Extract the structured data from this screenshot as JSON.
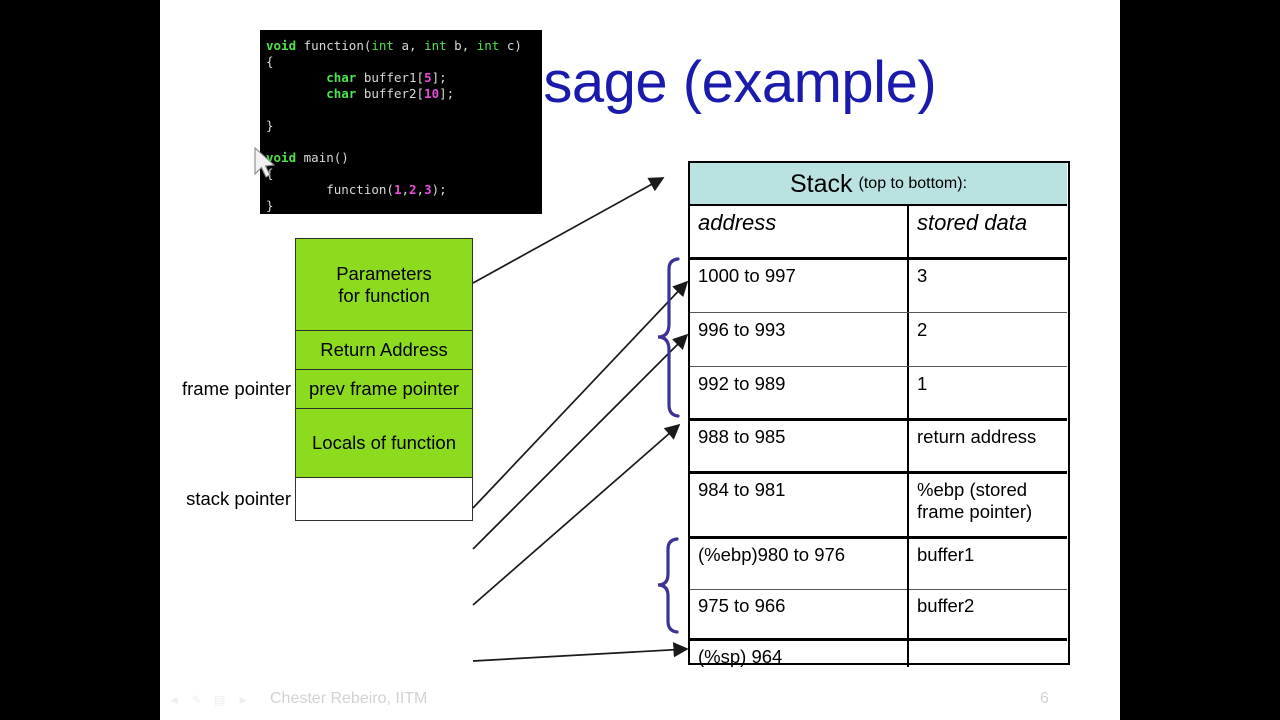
{
  "slide": {
    "title": "Stack Usage (example)"
  },
  "code": {
    "lines": [
      [
        {
          "t": "void ",
          "c": "kw"
        },
        {
          "t": "function(",
          "c": "pl"
        },
        {
          "t": "int",
          "c": "ty"
        },
        {
          "t": " a, ",
          "c": "pl"
        },
        {
          "t": "int",
          "c": "ty"
        },
        {
          "t": " b, ",
          "c": "pl"
        },
        {
          "t": "int",
          "c": "ty"
        },
        {
          "t": " c)",
          "c": "pl"
        }
      ],
      [
        {
          "t": "{",
          "c": "pl"
        }
      ],
      [
        {
          "t": "        ",
          "c": "pl"
        },
        {
          "t": "char",
          "c": "kw"
        },
        {
          "t": " buffer1[",
          "c": "pl"
        },
        {
          "t": "5",
          "c": "num"
        },
        {
          "t": "];",
          "c": "pl"
        }
      ],
      [
        {
          "t": "        ",
          "c": "pl"
        },
        {
          "t": "char",
          "c": "kw"
        },
        {
          "t": " buffer2[",
          "c": "pl"
        },
        {
          "t": "10",
          "c": "num"
        },
        {
          "t": "];",
          "c": "pl"
        }
      ],
      [
        {
          "t": "",
          "c": "pl"
        }
      ],
      [
        {
          "t": "}",
          "c": "pl"
        }
      ],
      [
        {
          "t": "",
          "c": "pl"
        }
      ],
      [
        {
          "t": "void ",
          "c": "kw"
        },
        {
          "t": "main()",
          "c": "pl"
        }
      ],
      [
        {
          "t": "{",
          "c": "pl"
        }
      ],
      [
        {
          "t": "        function(",
          "c": "pl"
        },
        {
          "t": "1",
          "c": "num"
        },
        {
          "t": ",",
          "c": "pl"
        },
        {
          "t": "2",
          "c": "num"
        },
        {
          "t": ",",
          "c": "pl"
        },
        {
          "t": "3",
          "c": "num"
        },
        {
          "t": ");",
          "c": "pl"
        }
      ],
      [
        {
          "t": "}",
          "c": "pl"
        }
      ]
    ]
  },
  "frame": {
    "boxes": [
      {
        "id": "params",
        "label": "Parameters\nfor function",
        "color": "#8ddb1e"
      },
      {
        "id": "return-address",
        "label": "Return Address",
        "color": "#8ddb1e"
      },
      {
        "id": "prev-frame-pointer",
        "label": "prev frame pointer",
        "color": "#8ddb1e"
      },
      {
        "id": "locals",
        "label": "Locals of function",
        "color": "#8ddb1e"
      },
      {
        "id": "free-space",
        "label": "",
        "color": "#ffffff"
      }
    ],
    "side_labels": {
      "frame_pointer": "frame pointer",
      "stack_pointer": "stack pointer"
    }
  },
  "table": {
    "header": {
      "main": "Stack",
      "note": "(top to bottom):",
      "bg": "#b9e2e0"
    },
    "columns": [
      "address",
      "stored data"
    ],
    "rows": [
      {
        "address": "1000 to 997",
        "stored_data": "3"
      },
      {
        "address": "996 to 993",
        "stored_data": "2"
      },
      {
        "address": "992 to 989",
        "stored_data": "1"
      },
      {
        "address": "988 to 985",
        "stored_data": "return address"
      },
      {
        "address": "984 to 981",
        "stored_data": "%ebp (stored\nframe pointer)"
      },
      {
        "address": "(%ebp)980 to 976",
        "stored_data": "buffer1"
      },
      {
        "address": "975 to 966",
        "stored_data": "buffer2"
      },
      {
        "address": "(%sp) 964",
        "stored_data": ""
      }
    ]
  },
  "colors": {
    "title": "#1a1aad",
    "brace": "#3b3494",
    "green": "#8ddb1e",
    "header_bg": "#b9e2e0",
    "connector": "#1a1a1a"
  },
  "footer": {
    "author": "Chester Rebeiro, IITM",
    "page": "6",
    "nav": [
      "prev-arrow-icon",
      "pen-icon",
      "slides-icon",
      "next-arrow-icon"
    ]
  }
}
